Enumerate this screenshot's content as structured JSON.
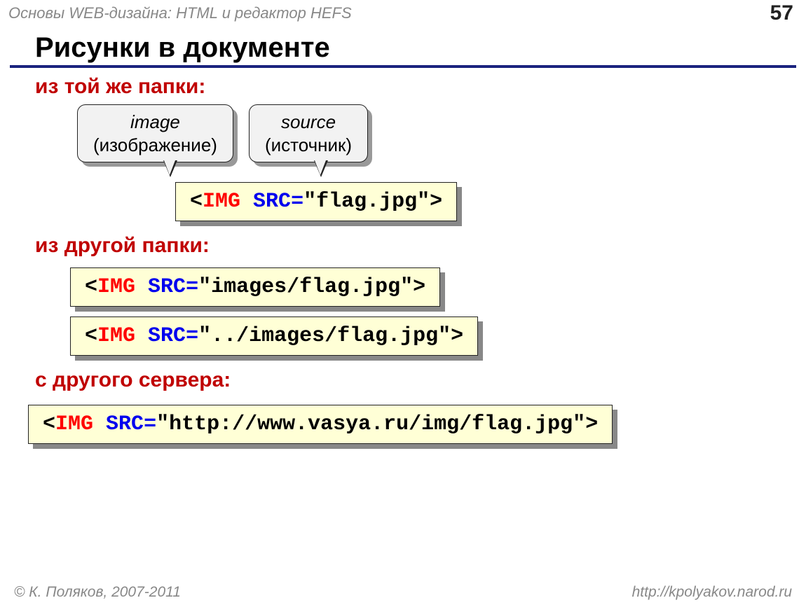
{
  "header": {
    "course": "Основы WEB-дизайна: HTML и редактор HEFS",
    "page": "57"
  },
  "title": "Рисунки в документе",
  "sections": {
    "sameFolder": {
      "label": "из той же папки:",
      "callouts": {
        "image": {
          "line1": "image",
          "line2": "(изображение)"
        },
        "source": {
          "line1": "source",
          "line2": "(источник)"
        }
      },
      "code": {
        "open": "<",
        "tag": "IMG",
        "sp": " ",
        "attr": "SRC",
        "eq": "=",
        "val": "\"flag.jpg\"",
        "close": ">"
      }
    },
    "otherFolder": {
      "label": "из другой папки:",
      "code1": {
        "open": "<",
        "tag": "IMG",
        "sp": " ",
        "attr": "SRC",
        "eq": "=",
        "val": "\"images/flag.jpg\"",
        "close": ">"
      },
      "code2": {
        "open": "<",
        "tag": "IMG",
        "sp": " ",
        "attr": "SRC",
        "eq": "=",
        "val": "\"../images/flag.jpg\"",
        "close": ">"
      }
    },
    "otherServer": {
      "label": "с другого сервера:",
      "code": {
        "open": "<",
        "tag": "IMG",
        "sp": " ",
        "attr": "SRC",
        "eq": "=",
        "val": "\"http://www.vasya.ru/img/flag.jpg\"",
        "close": ">"
      }
    }
  },
  "footer": {
    "copyright": "© К. Поляков, 2007-2011",
    "url": "http://kpolyakov.narod.ru"
  }
}
